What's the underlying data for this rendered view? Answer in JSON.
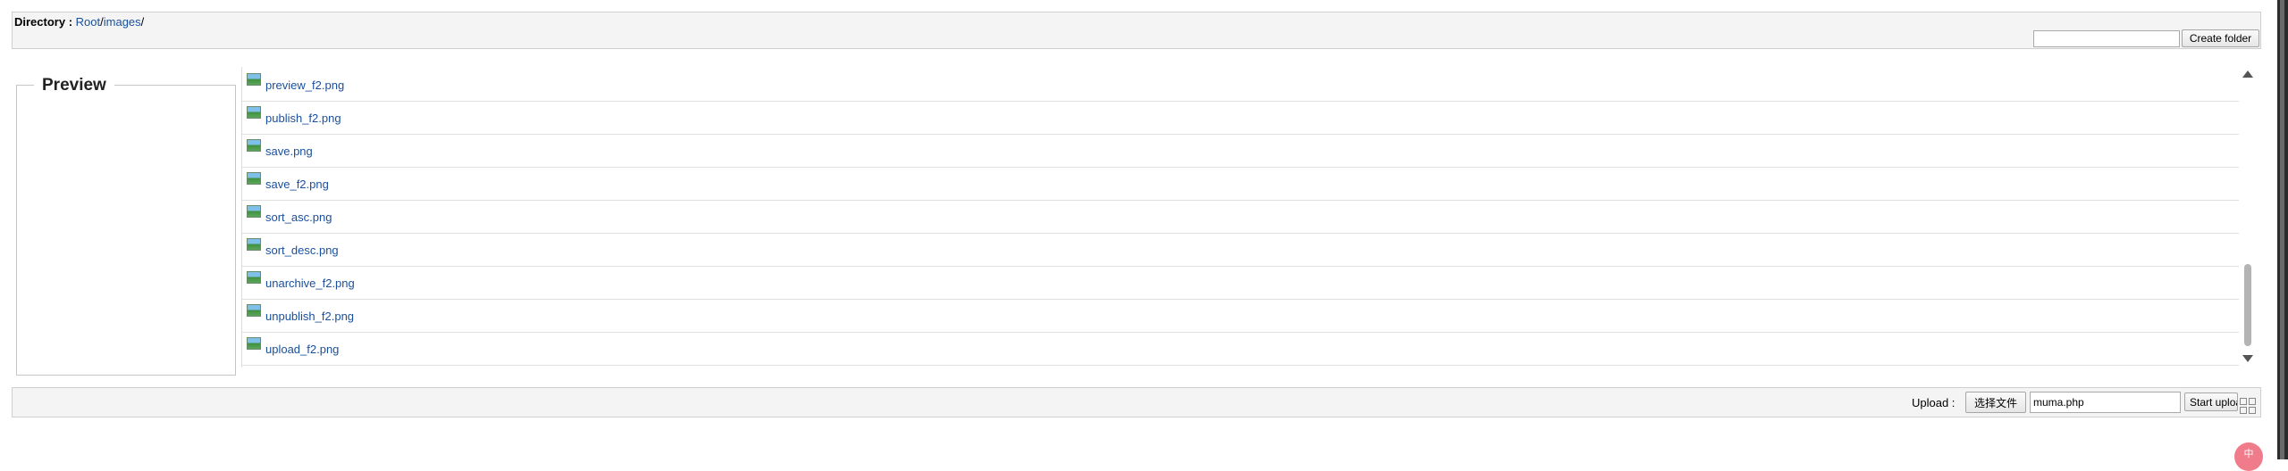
{
  "directory": {
    "label": "Directory :",
    "path": [
      {
        "text": "Root",
        "sep": "/"
      },
      {
        "text": "images",
        "sep": "/"
      }
    ]
  },
  "folder": {
    "input_value": "",
    "create_label": "Create folder"
  },
  "preview": {
    "legend": "Preview"
  },
  "files": [
    {
      "name": "preview_f2.png"
    },
    {
      "name": "publish_f2.png"
    },
    {
      "name": "save.png"
    },
    {
      "name": "save_f2.png"
    },
    {
      "name": "sort_asc.png"
    },
    {
      "name": "sort_desc.png"
    },
    {
      "name": "unarchive_f2.png"
    },
    {
      "name": "unpublish_f2.png"
    },
    {
      "name": "upload_f2.png"
    }
  ],
  "upload": {
    "label": "Upload :",
    "choose_label": "选择文件",
    "file_value": "muma.php",
    "start_label": "Start upload"
  },
  "overlay": {
    "badge_text": "中"
  },
  "icons": {
    "file": "image-file-icon",
    "scroll_up": "chevron-up-icon",
    "scroll_down": "chevron-down-icon",
    "grid": "grid-icon"
  }
}
